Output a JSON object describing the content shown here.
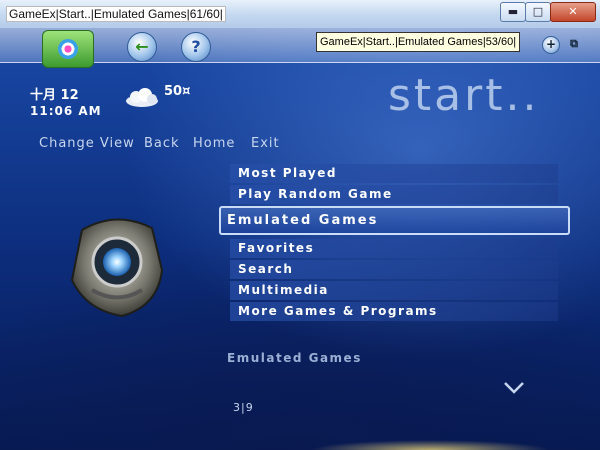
{
  "window": {
    "title": "GameEx|Start..|Emulated Games|61/60|",
    "minimize": "▬",
    "maximize": "□",
    "close": "✕"
  },
  "topbar": {
    "tooltip": "GameEx|Start..|Emulated Games|53/60|",
    "back_glyph": "←",
    "help_glyph": "?",
    "plus_glyph": "+",
    "restore_glyph": "⧉"
  },
  "info": {
    "date": "十月 12",
    "time": "11:06 AM",
    "temperature": "50¤"
  },
  "page_title": "start..",
  "nav": {
    "change_view": "Change View",
    "back": "Back",
    "home": "Home",
    "exit": "Exit"
  },
  "menu": {
    "items_top": [
      "Most Played",
      "Play Random Game"
    ],
    "selected": "Emulated Games",
    "items_bottom": [
      "Favorites",
      "Search",
      "Multimedia",
      "More Games & Programs"
    ]
  },
  "footer": {
    "label": "Emulated Games",
    "page": "3|9"
  }
}
